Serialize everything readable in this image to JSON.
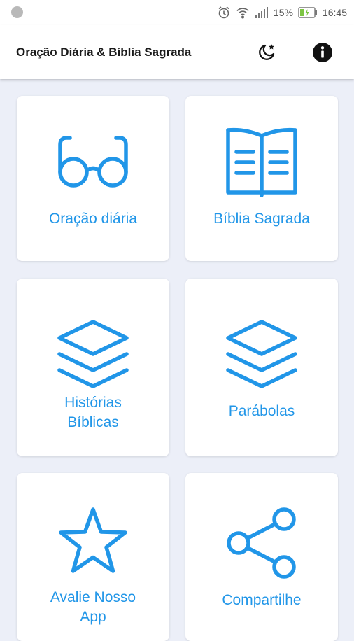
{
  "status_bar": {
    "battery_percent": "15%",
    "time": "16:45"
  },
  "app_bar": {
    "title": "Oração Diária & Bíblia Sagrada",
    "night_mode_icon": "moon-star-icon",
    "info_icon": "info-icon"
  },
  "colors": {
    "accent": "#2196e8",
    "background": "#eceff8",
    "card": "#ffffff"
  },
  "menu": {
    "daily_prayer": {
      "label": "Oração diária",
      "icon": "glasses-icon"
    },
    "holy_bible": {
      "label": "Bíblia Sagrada",
      "icon": "open-book-icon"
    },
    "bible_stories": {
      "label_line1": "Histórias",
      "label_line2": "Bíblicas",
      "icon": "layers-icon"
    },
    "parables": {
      "label": "Parábolas",
      "icon": "layers-icon"
    },
    "rate_app": {
      "label_line1": "Avalie Nosso",
      "label_line2": "App",
      "icon": "star-icon"
    },
    "share": {
      "label": "Compartilhe",
      "icon": "share-icon"
    }
  }
}
